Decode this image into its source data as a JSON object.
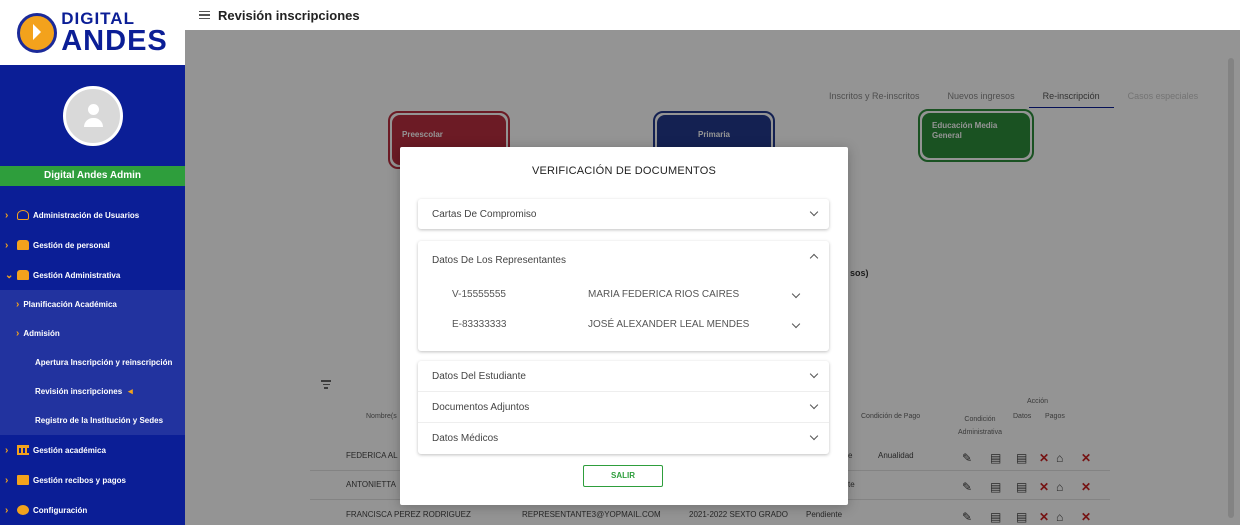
{
  "brand": {
    "line1": "DIGITAL",
    "line2": "ANDES"
  },
  "user": {
    "name": "Digital Andes Admin"
  },
  "sidebar": {
    "items": [
      {
        "label": "Administración de Usuarios"
      },
      {
        "label": "Gestión de personal"
      },
      {
        "label": "Gestión Administrativa"
      }
    ],
    "sub": {
      "planificacion": "Planificación Académica",
      "admision": "Admisión"
    },
    "sub2": {
      "apertura": "Apertura Inscripción y reinscripción",
      "revision": "Revisión inscripciones",
      "registro": "Registro de la Institución y Sedes"
    },
    "bottom": [
      {
        "label": "Gestión académica"
      },
      {
        "label": "Gestión recibos y pagos"
      },
      {
        "label": "Configuración"
      }
    ]
  },
  "header": {
    "title": "Revisión inscripciones"
  },
  "tabs": [
    "Inscritos y Re-inscritos",
    "Nuevos ingresos",
    "Re-inscripción",
    "Casos especiales"
  ],
  "levels": {
    "preescolar": "Preescolar",
    "primaria": "Primaria",
    "media": "Educación Media General"
  },
  "bg_fragment": {
    "a": "sos)"
  },
  "table": {
    "headers": {
      "nombre": "Nombre(s",
      "condicion_pago": "Condición de Pago",
      "accion": "Acción",
      "cond_admin": "Condición Administrativa",
      "datos": "Datos",
      "pagos": "Pagos"
    },
    "rows": [
      {
        "name": "FEDERICA AL",
        "email": "",
        "period": "",
        "status": "e",
        "pago": "Anualidad"
      },
      {
        "name": "ANTONIETTA",
        "email": "",
        "period": "",
        "status": "te",
        "pago": ""
      },
      {
        "name": "FRANCISCA PEREZ RODRIGUEZ",
        "email": "REPRESENTANTE3@YOPMAIL.COM",
        "period": "2021-2022 SEXTO GRADO",
        "status": "Pendiente",
        "pago": ""
      }
    ]
  },
  "modal": {
    "title": "VERIFICACIÓN DE DOCUMENTOS",
    "cartas": "Cartas De Compromiso",
    "representantes": "Datos De Los Representantes",
    "reps": [
      {
        "id": "V-15555555",
        "name": "MARIA FEDERICA RIOS CAIRES"
      },
      {
        "id": "E-83333333",
        "name": "JOSÉ ALEXANDER LEAL MENDES"
      }
    ],
    "estudiante": "Datos Del Estudiante",
    "adjuntos": "Documentos Adjuntos",
    "medicos": "Datos Médicos",
    "salir": "SALIR"
  },
  "icons": {
    "sidebar_accent": "#f3a21c",
    "sidebar_bg": "#0b1e96",
    "profile_bar": "#2e9e3c"
  }
}
